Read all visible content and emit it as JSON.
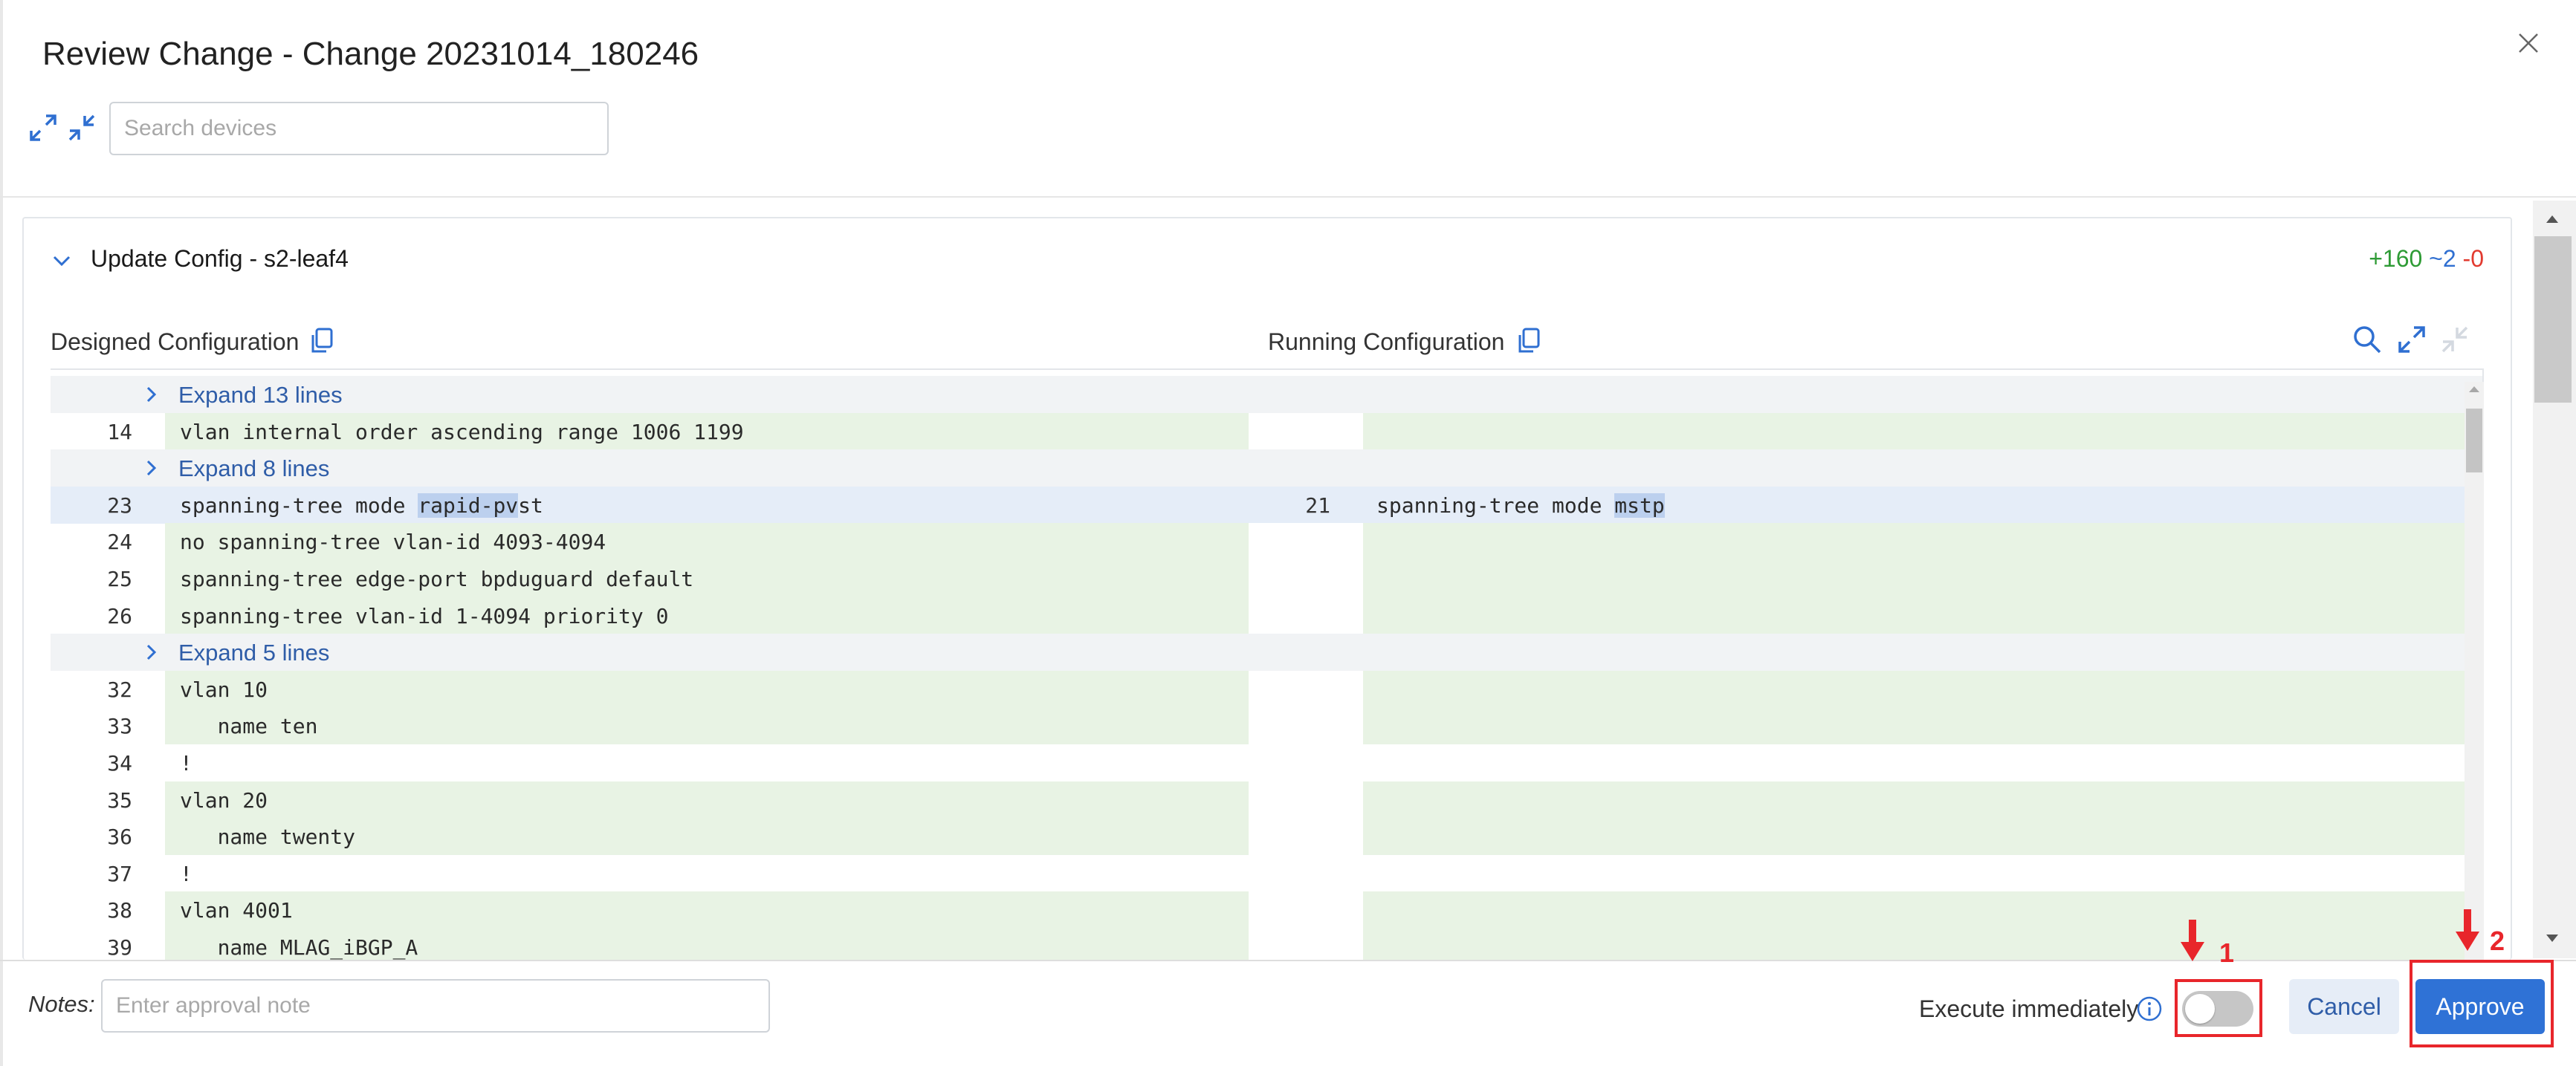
{
  "dialog": {
    "title": "Review Change - Change 20231014_180246",
    "search_placeholder": "Search devices"
  },
  "card": {
    "title": "Update Config - s2-leaf4",
    "stats": {
      "added": "+160",
      "modified": "~2",
      "deleted": "-0"
    }
  },
  "diff": {
    "designed_label": "Designed Configuration",
    "running_label": "Running Configuration",
    "rows": [
      {
        "type": "expand",
        "label": "Expand 13 lines"
      },
      {
        "type": "add",
        "left_ln": "14",
        "left": "vlan internal order ascending range 1006 1199",
        "right_ln": "",
        "right": ""
      },
      {
        "type": "expand",
        "label": "Expand 8 lines"
      },
      {
        "type": "chg",
        "left_ln": "23",
        "left_pre": "spanning-tree mode ",
        "left_hl": "rapid-pv",
        "left_post": "st",
        "right_ln": "21",
        "right_pre": "spanning-tree mode ",
        "right_hl": "mstp",
        "right_post": ""
      },
      {
        "type": "add",
        "left_ln": "24",
        "left": "no spanning-tree vlan-id 4093-4094",
        "right_ln": "",
        "right": ""
      },
      {
        "type": "add",
        "left_ln": "25",
        "left": "spanning-tree edge-port bpduguard default",
        "right_ln": "",
        "right": ""
      },
      {
        "type": "add",
        "left_ln": "26",
        "left": "spanning-tree vlan-id 1-4094 priority 0",
        "right_ln": "",
        "right": ""
      },
      {
        "type": "expand",
        "label": "Expand 5 lines"
      },
      {
        "type": "add",
        "left_ln": "32",
        "left": "vlan 10",
        "right_ln": "",
        "right": ""
      },
      {
        "type": "add",
        "left_ln": "33",
        "left": "   name ten",
        "right_ln": "",
        "right": ""
      },
      {
        "type": "plain",
        "left_ln": "34",
        "left": "!",
        "right_ln": "",
        "right": ""
      },
      {
        "type": "add",
        "left_ln": "35",
        "left": "vlan 20",
        "right_ln": "",
        "right": ""
      },
      {
        "type": "add",
        "left_ln": "36",
        "left": "   name twenty",
        "right_ln": "",
        "right": ""
      },
      {
        "type": "plain",
        "left_ln": "37",
        "left": "!",
        "right_ln": "",
        "right": ""
      },
      {
        "type": "add",
        "left_ln": "38",
        "left": "vlan 4001",
        "right_ln": "",
        "right": ""
      },
      {
        "type": "add",
        "left_ln": "39",
        "left": "   name MLAG_iBGP_A",
        "right_ln": "",
        "right": ""
      }
    ]
  },
  "footer": {
    "notes_label": "Notes:",
    "notes_placeholder": "Enter approval note",
    "execute_label": "Execute immediately",
    "execute_enabled": false,
    "cancel_label": "Cancel",
    "approve_label": "Approve"
  },
  "annotations": {
    "marker_1": "1",
    "marker_2": "2"
  },
  "colors": {
    "accent": "#2f72d6",
    "added_bg": "#e8f3e4",
    "changed_bg": "#e5edf8",
    "highlight": "#bcd0ee",
    "annotation_red": "#e8262b"
  }
}
